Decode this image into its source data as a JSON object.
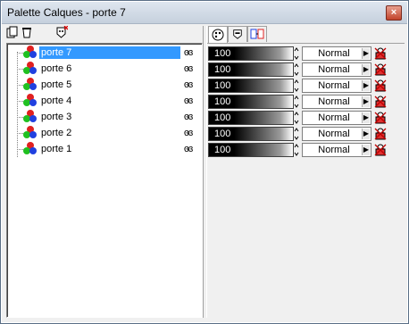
{
  "window": {
    "title": "Palette Calques - porte 7",
    "close_label": "×"
  },
  "layers": [
    {
      "name": "porte 7",
      "selected": true
    },
    {
      "name": "porte 6"
    },
    {
      "name": "porte 5"
    },
    {
      "name": "porte 4"
    },
    {
      "name": "porte 3"
    },
    {
      "name": "porte 2"
    },
    {
      "name": "porte 1"
    }
  ],
  "visibility_glyph": "ɞɞ",
  "properties": {
    "opacity_values": [
      "100",
      "100",
      "100",
      "100",
      "100",
      "100",
      "100"
    ],
    "blend_modes": [
      "Normal",
      "Normal",
      "Normal",
      "Normal",
      "Normal",
      "Normal",
      "Normal"
    ]
  },
  "icons": {
    "new_layer": "new-layer-icon",
    "delete": "trash-icon",
    "mask": "mask-icon",
    "tab_properties": "palette-icon",
    "tab_mask": "mask-tab-icon",
    "tab_links": "link-tab-icon",
    "lock": "lock-icon"
  },
  "colors": {
    "selection": "#3399ff",
    "red": "#e02020",
    "green": "#20c020",
    "blue": "#2040e0"
  }
}
